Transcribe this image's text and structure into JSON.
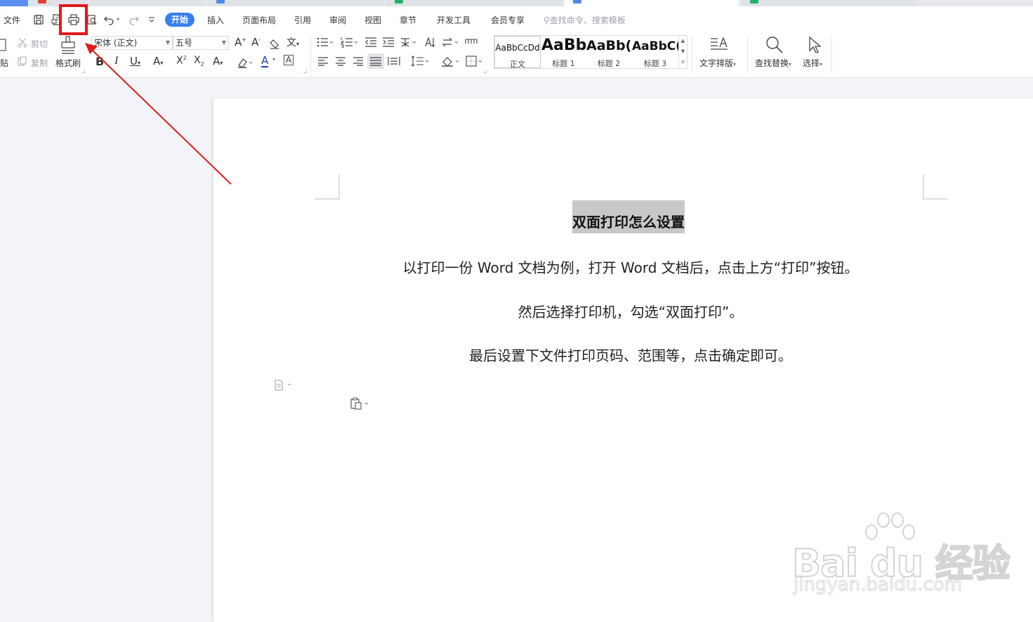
{
  "menu": {
    "file": "文件",
    "tabs": [
      {
        "label": "开始",
        "active": true
      },
      {
        "label": "插入"
      },
      {
        "label": "页面布局"
      },
      {
        "label": "引用"
      },
      {
        "label": "审阅"
      },
      {
        "label": "视图"
      },
      {
        "label": "章节"
      },
      {
        "label": "开发工具"
      },
      {
        "label": "会员专享"
      }
    ],
    "search_hint": "查找命令、搜索模板",
    "quick_access_icons": [
      "save-icon",
      "export-pdf-icon",
      "print-icon",
      "print-preview-icon",
      "undo-icon",
      "redo-icon",
      "customize-icon"
    ]
  },
  "ribbon": {
    "paste_fragment": "贴",
    "cut": "剪切",
    "copy": "复制",
    "format_painter": "格式刷",
    "font_name": "宋体 (正文)",
    "font_size": "五号",
    "styles": [
      {
        "sample": "AaBbCcDd",
        "label": "正文"
      },
      {
        "sample": "AaBb",
        "label": "标题 1"
      },
      {
        "sample": "AaBb(",
        "label": "标题 2"
      },
      {
        "sample": "AaBbC(",
        "label": "标题 3"
      }
    ],
    "text_layout": "文字排版",
    "find_replace": "查找替换",
    "select": "选择"
  },
  "document": {
    "title": "双面打印怎么设置",
    "paragraphs": [
      "以打印一份 Word 文档为例，打开 Word 文档后，点击上方“打印”按钮。",
      "然后选择打印机，勾选“双面打印”。",
      "最后设置下文件打印页码、范围等，点击确定即可。"
    ]
  },
  "watermark": {
    "logo": "Bai du 经验",
    "url": "jingyan.baidu.com"
  },
  "colors": {
    "accent": "#3a7ff0",
    "annotation": "#e01a1a",
    "title_highlight": "#c8c8c8"
  }
}
